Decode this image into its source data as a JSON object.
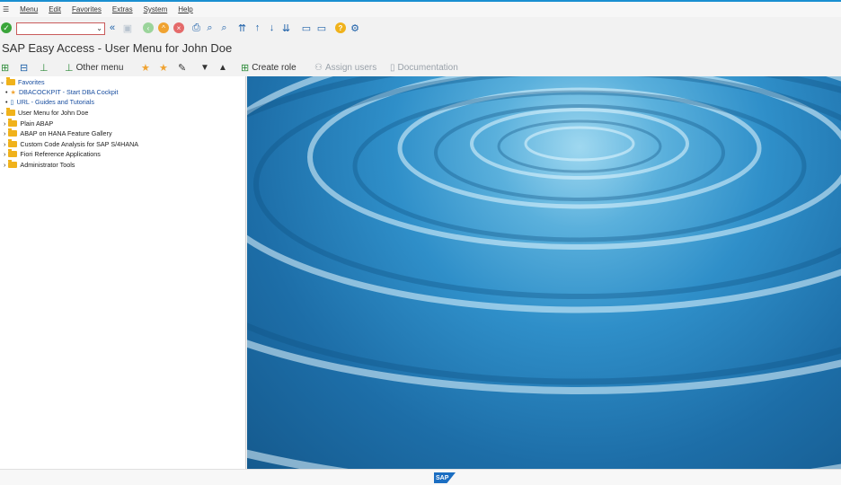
{
  "menubar": {
    "items": [
      "Menu",
      "Edit",
      "Favorites",
      "Extras",
      "System",
      "Help"
    ]
  },
  "toolbar1": {
    "command_value": ""
  },
  "title": "SAP Easy Access  -  User Menu for John Doe",
  "toolbar2": {
    "other_menu": "Other menu",
    "create_role": "Create role",
    "assign_users": "Assign users",
    "documentation": "Documentation"
  },
  "tree": {
    "favorites": "Favorites",
    "fav_items": [
      "DBACOCKPIT - Start DBA Cockpit",
      "URL - Guides and Tutorials"
    ],
    "user_menu": "User Menu for John Doe",
    "folders": [
      "Plain ABAP",
      "ABAP on HANA Feature Gallery",
      "Custom Code Analysis for SAP S/4HANA",
      "Fiori Reference Applications",
      "Administrator Tools"
    ]
  },
  "status": {
    "logo": "SAP"
  },
  "colors": {
    "accent": "#1a8fd1",
    "folder": "#f0b21b",
    "link": "#1a4fa0"
  }
}
